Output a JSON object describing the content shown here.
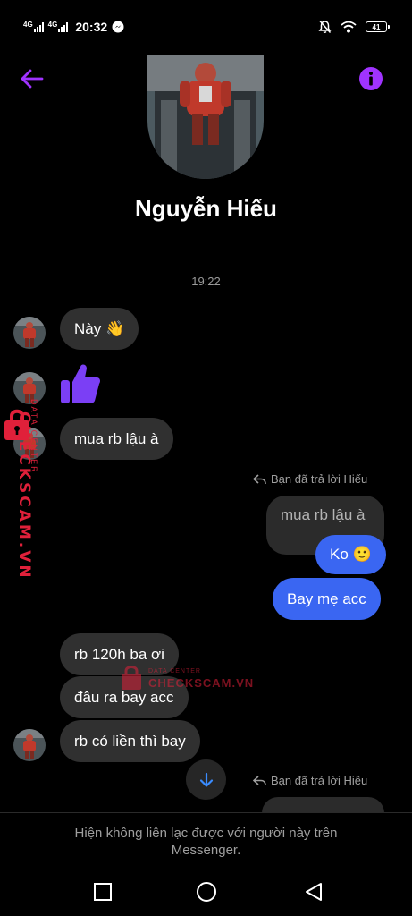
{
  "status_bar": {
    "network_1": "4G",
    "network_2": "4G",
    "time": "20:32",
    "battery": "41"
  },
  "header": {
    "contact_name": "Nguyễn Hiếu"
  },
  "conversation": {
    "timestamp": "19:22",
    "messages": [
      {
        "sender": "contact",
        "text": "Này 👋"
      },
      {
        "sender": "contact",
        "type": "like",
        "icon": "thumbs-up-icon"
      },
      {
        "sender": "contact",
        "text": "mua rb lậu à"
      },
      {
        "sender": "me",
        "reply_label": "Bạn đã trả lời Hiếu",
        "quoted": "mua rb lậu à",
        "text": "Ko 🙂"
      },
      {
        "sender": "me",
        "text": "Bay mẹ acc"
      },
      {
        "sender": "contact",
        "text": "rb 120h ba ơi"
      },
      {
        "sender": "contact",
        "text": "đâu ra bay acc"
      },
      {
        "sender": "contact",
        "text": "rb có liền thì bay"
      },
      {
        "sender": "me",
        "reply_label": "Bạn đã trả lời Hiếu"
      }
    ]
  },
  "watermark": {
    "side_top": "DATA CENTER",
    "side_main": "CHECKSCAM.VN",
    "mid_top": "DATA CENTER",
    "mid_main": "CHECKSCAM.VN"
  },
  "footer": {
    "notice": "Hiện không liên lạc được với người này trên Messenger."
  },
  "colors": {
    "accent": "#a033ff",
    "outgoing_bubble": "#3a66f2",
    "incoming_bubble": "#303030",
    "watermark": "#e0203a"
  }
}
